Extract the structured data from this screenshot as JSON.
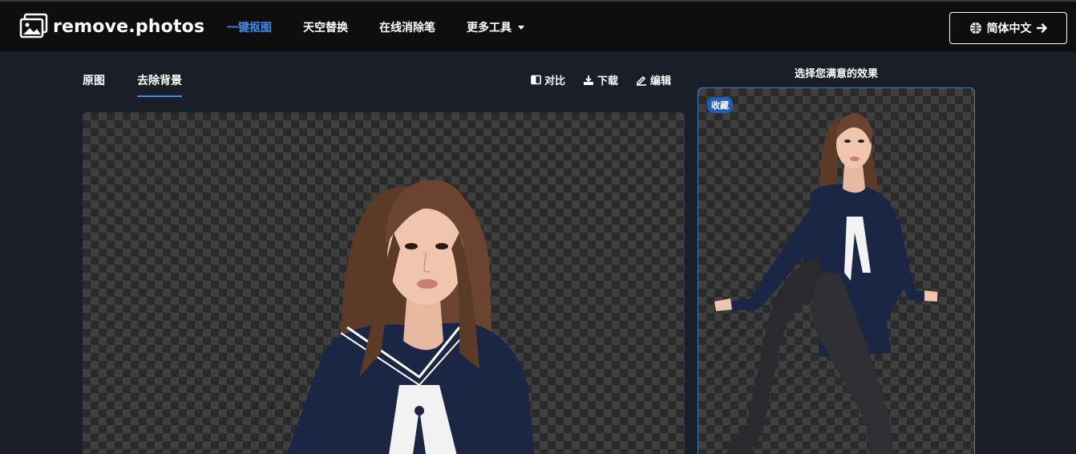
{
  "header": {
    "logo_text": "remove.photos",
    "nav": [
      {
        "label": "一键抠图",
        "active": true
      },
      {
        "label": "天空替换",
        "active": false
      },
      {
        "label": "在线消除笔",
        "active": false
      },
      {
        "label": "更多工具",
        "active": false,
        "dropdown": true
      }
    ],
    "language_button": "简体中文"
  },
  "view_tabs": [
    {
      "label": "原图",
      "active": false
    },
    {
      "label": "去除背景",
      "active": true
    }
  ],
  "tools": {
    "compare": "对比",
    "download": "下载",
    "edit": "编辑"
  },
  "results": {
    "title": "选择您满意的效果",
    "badge": "收藏"
  },
  "colors": {
    "accent": "#3c8ef0",
    "background": "#1a1f27",
    "topbar": "#0e0e0e",
    "selected_border": "#3c7fd9"
  }
}
